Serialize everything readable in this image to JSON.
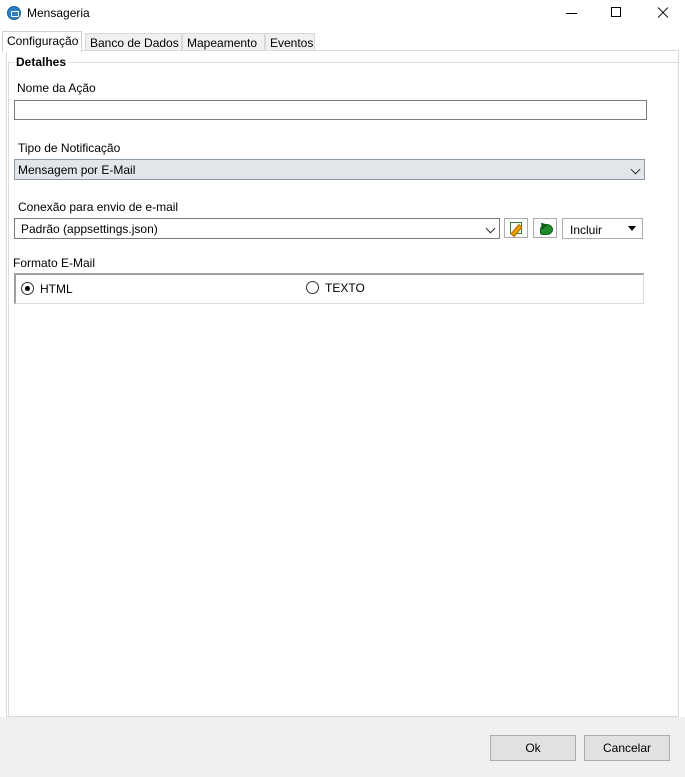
{
  "window": {
    "title": "Mensageria",
    "icon": "app-envelope-icon"
  },
  "tabs": [
    {
      "label": "Configuração",
      "active": true
    },
    {
      "label": "Banco de Dados",
      "active": false
    },
    {
      "label": "Mapeamento",
      "active": false
    },
    {
      "label": "Eventos",
      "active": false
    }
  ],
  "details": {
    "group_title": "Detalhes",
    "action_name": {
      "label": "Nome da Ação",
      "value": ""
    },
    "notification_type": {
      "label": "Tipo de Notificação",
      "value": "Mensagem por E-Mail"
    },
    "email_connection": {
      "label": "Conexão para envio de e-mail",
      "value": "Padrão (appsettings.json)",
      "edit_icon": "pencil-edit-icon",
      "refresh_icon": "refresh-icon",
      "include_label": "Incluir"
    },
    "email_format": {
      "label": "Formato E-Mail",
      "options": [
        {
          "label": "HTML",
          "checked": true
        },
        {
          "label": "TEXTO",
          "checked": false
        }
      ]
    }
  },
  "footer": {
    "ok_label": "Ok",
    "cancel_label": "Cancelar"
  }
}
